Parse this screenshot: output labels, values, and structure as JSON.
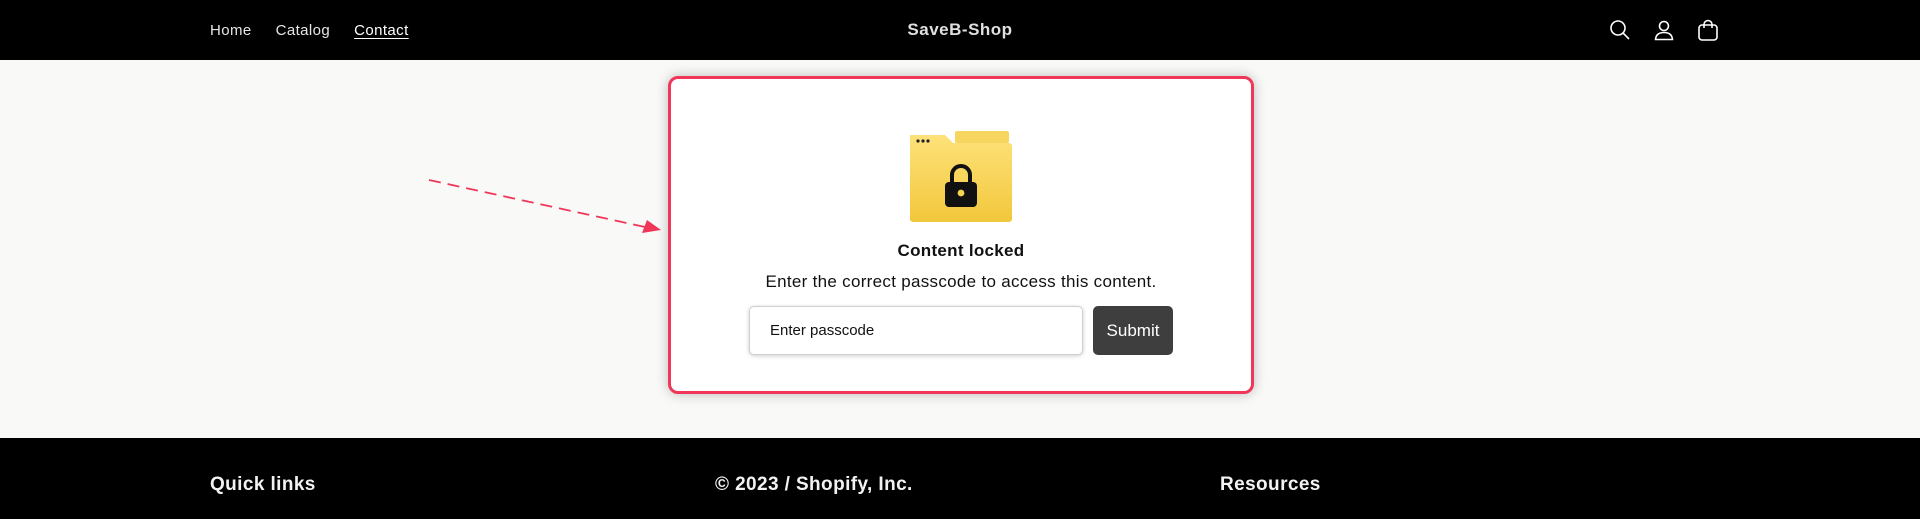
{
  "header": {
    "nav": [
      {
        "label": "Home"
      },
      {
        "label": "Catalog"
      },
      {
        "label": "Contact"
      }
    ],
    "logo": "SaveB-Shop",
    "icons": [
      "search-icon",
      "account-icon",
      "cart-icon"
    ]
  },
  "locked": {
    "title": "Content locked",
    "description": "Enter the correct passcode to access this content.",
    "input_placeholder": "Enter passcode",
    "submit_label": "Submit",
    "icon": "locked-folder-icon"
  },
  "colors": {
    "header_bg": "#000000",
    "card_border": "#f0375a",
    "button_bg": "#3e3e3e",
    "folder_yellow": "#f5d24f"
  },
  "footer": {
    "quick_links": "Quick links",
    "copyright": "© 2023 / Shopify, Inc.",
    "resources": "Resources"
  }
}
